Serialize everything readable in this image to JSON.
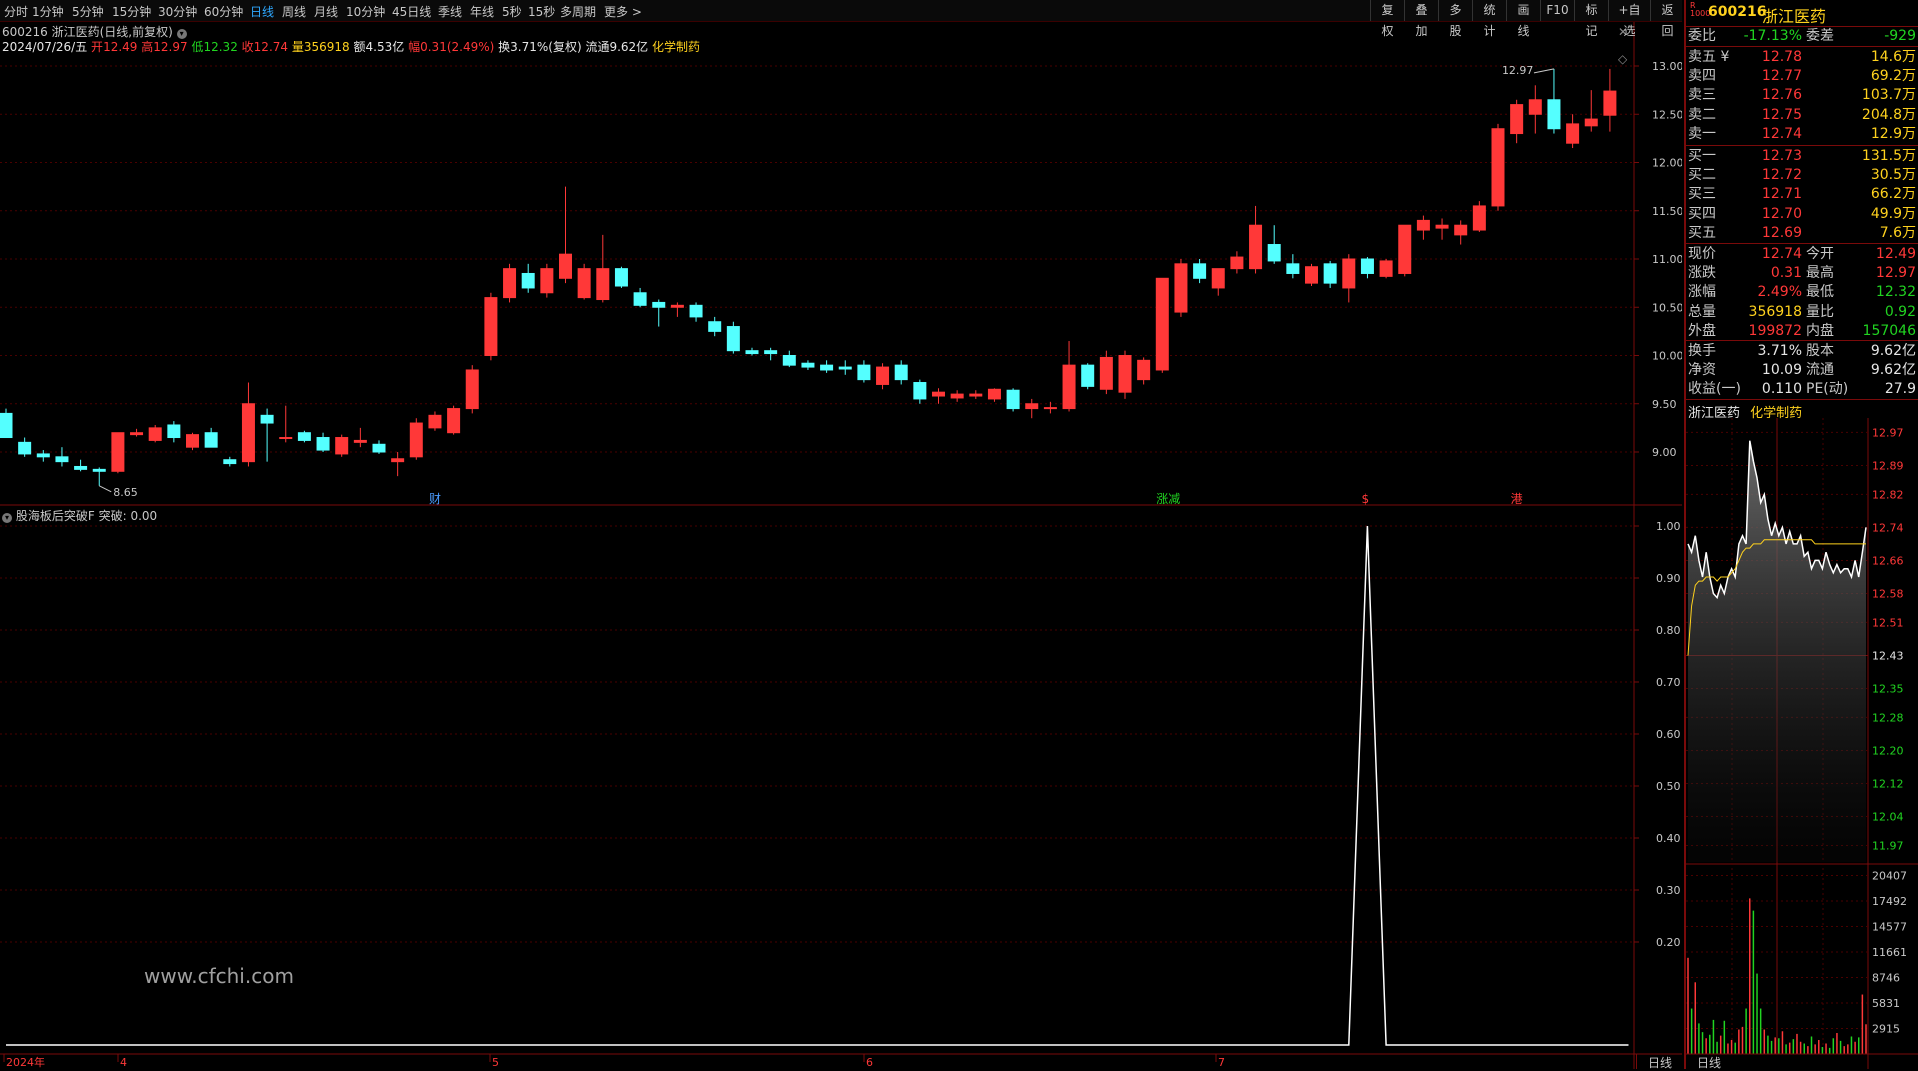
{
  "toolbar": {
    "periods": [
      "分时",
      "1分钟",
      "5分钟",
      "15分钟",
      "30分钟",
      "60分钟",
      "日线",
      "周线",
      "月线",
      "10分钟",
      "45日线",
      "季线",
      "年线",
      "5秒",
      "15秒",
      "多周期",
      "更多 >"
    ],
    "active_period": "日线",
    "right_buttons": [
      "复权",
      "叠加",
      "多股",
      "统计",
      "画线",
      "F10",
      "标记",
      "+自选",
      "返回"
    ]
  },
  "stock": {
    "code": "600216",
    "name": "浙江医药",
    "title_line": "600216 浙江医药(日线,前复权)",
    "industry": "化学制药",
    "date": "2024/07/26/五",
    "open_label": "开",
    "open": "12.49",
    "high_label": "高",
    "high": "12.97",
    "low_label": "低",
    "low": "12.32",
    "close_label": "收",
    "close": "12.74",
    "vol_label": "量",
    "volume": "356918",
    "amount_label": "额",
    "amount": "4.53亿",
    "change_label": "幅",
    "change": "0.31(2.49%)",
    "turnover_text": "换3.71%(复权) 流通9.62亿"
  },
  "chart_data": {
    "type": "candlestick",
    "title": "600216 浙江医药(日线,前复权)",
    "price_axis": [
      "13.00",
      "12.50",
      "12.00",
      "11.50",
      "11.00",
      "10.50",
      "10.00",
      "9.50",
      "9.00"
    ],
    "ylim": [
      8.4,
      13.3
    ],
    "candles": [
      {
        "o": 9.4,
        "h": 9.45,
        "l": 9.15,
        "c": 9.15
      },
      {
        "o": 9.1,
        "h": 9.15,
        "l": 8.95,
        "c": 8.98
      },
      {
        "o": 8.98,
        "h": 9.02,
        "l": 8.9,
        "c": 8.95
      },
      {
        "o": 8.95,
        "h": 9.05,
        "l": 8.85,
        "c": 8.9
      },
      {
        "o": 8.85,
        "h": 8.92,
        "l": 8.8,
        "c": 8.82
      },
      {
        "o": 8.82,
        "h": 8.84,
        "l": 8.65,
        "c": 8.8
      },
      {
        "o": 8.8,
        "h": 9.2,
        "l": 8.78,
        "c": 9.2
      },
      {
        "o": 9.18,
        "h": 9.24,
        "l": 9.16,
        "c": 9.2
      },
      {
        "o": 9.12,
        "h": 9.28,
        "l": 9.1,
        "c": 9.25
      },
      {
        "o": 9.28,
        "h": 9.32,
        "l": 9.1,
        "c": 9.15
      },
      {
        "o": 9.05,
        "h": 9.2,
        "l": 9.02,
        "c": 9.18
      },
      {
        "o": 9.2,
        "h": 9.25,
        "l": 9.05,
        "c": 9.05
      },
      {
        "o": 8.92,
        "h": 8.95,
        "l": 8.85,
        "c": 8.88
      },
      {
        "o": 8.9,
        "h": 9.72,
        "l": 8.85,
        "c": 9.5
      },
      {
        "o": 9.38,
        "h": 9.45,
        "l": 8.9,
        "c": 9.3
      },
      {
        "o": 9.15,
        "h": 9.48,
        "l": 9.1,
        "c": 9.15
      },
      {
        "o": 9.2,
        "h": 9.22,
        "l": 9.1,
        "c": 9.12
      },
      {
        "o": 9.15,
        "h": 9.2,
        "l": 9.0,
        "c": 9.02
      },
      {
        "o": 8.98,
        "h": 9.18,
        "l": 8.95,
        "c": 9.15
      },
      {
        "o": 9.1,
        "h": 9.25,
        "l": 9.05,
        "c": 9.12
      },
      {
        "o": 9.08,
        "h": 9.12,
        "l": 8.98,
        "c": 9.0
      },
      {
        "o": 8.9,
        "h": 9.0,
        "l": 8.75,
        "c": 8.93
      },
      {
        "o": 8.95,
        "h": 9.35,
        "l": 8.92,
        "c": 9.3
      },
      {
        "o": 9.25,
        "h": 9.42,
        "l": 9.22,
        "c": 9.38
      },
      {
        "o": 9.2,
        "h": 9.48,
        "l": 9.18,
        "c": 9.45
      },
      {
        "o": 9.45,
        "h": 9.9,
        "l": 9.4,
        "c": 9.85
      },
      {
        "o": 10.0,
        "h": 10.65,
        "l": 9.95,
        "c": 10.6
      },
      {
        "o": 10.6,
        "h": 10.95,
        "l": 10.55,
        "c": 10.9
      },
      {
        "o": 10.85,
        "h": 10.95,
        "l": 10.65,
        "c": 10.7
      },
      {
        "o": 10.65,
        "h": 10.95,
        "l": 10.6,
        "c": 10.9
      },
      {
        "o": 10.8,
        "h": 11.75,
        "l": 10.75,
        "c": 11.05
      },
      {
        "o": 10.6,
        "h": 10.95,
        "l": 10.58,
        "c": 10.9
      },
      {
        "o": 10.58,
        "h": 11.25,
        "l": 10.55,
        "c": 10.9
      },
      {
        "o": 10.9,
        "h": 10.92,
        "l": 10.7,
        "c": 10.72
      },
      {
        "o": 10.65,
        "h": 10.7,
        "l": 10.5,
        "c": 10.52
      },
      {
        "o": 10.55,
        "h": 10.58,
        "l": 10.3,
        "c": 10.5
      },
      {
        "o": 10.5,
        "h": 10.55,
        "l": 10.4,
        "c": 10.52
      },
      {
        "o": 10.52,
        "h": 10.55,
        "l": 10.35,
        "c": 10.4
      },
      {
        "o": 10.35,
        "h": 10.4,
        "l": 10.2,
        "c": 10.25
      },
      {
        "o": 10.3,
        "h": 10.35,
        "l": 10.02,
        "c": 10.05
      },
      {
        "o": 10.05,
        "h": 10.08,
        "l": 10.0,
        "c": 10.02
      },
      {
        "o": 10.05,
        "h": 10.08,
        "l": 9.95,
        "c": 10.02
      },
      {
        "o": 10.0,
        "h": 10.05,
        "l": 9.88,
        "c": 9.9
      },
      {
        "o": 9.92,
        "h": 9.95,
        "l": 9.85,
        "c": 9.88
      },
      {
        "o": 9.9,
        "h": 9.95,
        "l": 9.82,
        "c": 9.85
      },
      {
        "o": 9.88,
        "h": 9.95,
        "l": 9.8,
        "c": 9.86
      },
      {
        "o": 9.9,
        "h": 9.95,
        "l": 9.72,
        "c": 9.75
      },
      {
        "o": 9.7,
        "h": 9.92,
        "l": 9.65,
        "c": 9.88
      },
      {
        "o": 9.9,
        "h": 9.95,
        "l": 9.7,
        "c": 9.75
      },
      {
        "o": 9.72,
        "h": 9.75,
        "l": 9.5,
        "c": 9.55
      },
      {
        "o": 9.58,
        "h": 9.66,
        "l": 9.5,
        "c": 9.62
      },
      {
        "o": 9.56,
        "h": 9.64,
        "l": 9.52,
        "c": 9.6
      },
      {
        "o": 9.58,
        "h": 9.64,
        "l": 9.55,
        "c": 9.6
      },
      {
        "o": 9.55,
        "h": 9.66,
        "l": 9.52,
        "c": 9.65
      },
      {
        "o": 9.64,
        "h": 9.66,
        "l": 9.42,
        "c": 9.45
      },
      {
        "o": 9.45,
        "h": 9.55,
        "l": 9.35,
        "c": 9.5
      },
      {
        "o": 9.45,
        "h": 9.52,
        "l": 9.4,
        "c": 9.46
      },
      {
        "o": 9.45,
        "h": 10.15,
        "l": 9.42,
        "c": 9.9
      },
      {
        "o": 9.9,
        "h": 9.92,
        "l": 9.65,
        "c": 9.68
      },
      {
        "o": 9.65,
        "h": 10.05,
        "l": 9.6,
        "c": 9.98
      },
      {
        "o": 9.62,
        "h": 10.05,
        "l": 9.55,
        "c": 10.0
      },
      {
        "o": 9.75,
        "h": 9.98,
        "l": 9.7,
        "c": 9.95
      },
      {
        "o": 9.85,
        "h": 10.2,
        "l": 9.82,
        "c": 10.8
      },
      {
        "o": 10.45,
        "h": 11.0,
        "l": 10.4,
        "c": 10.95
      },
      {
        "o": 10.95,
        "h": 11.0,
        "l": 10.75,
        "c": 10.8
      },
      {
        "o": 10.7,
        "h": 10.9,
        "l": 10.62,
        "c": 10.9
      },
      {
        "o": 10.9,
        "h": 11.08,
        "l": 10.85,
        "c": 11.02
      },
      {
        "o": 10.9,
        "h": 11.55,
        "l": 10.85,
        "c": 11.35
      },
      {
        "o": 11.15,
        "h": 11.35,
        "l": 10.95,
        "c": 10.98
      },
      {
        "o": 10.95,
        "h": 11.05,
        "l": 10.8,
        "c": 10.85
      },
      {
        "o": 10.75,
        "h": 10.95,
        "l": 10.72,
        "c": 10.92
      },
      {
        "o": 10.95,
        "h": 10.98,
        "l": 10.7,
        "c": 10.75
      },
      {
        "o": 10.7,
        "h": 11.05,
        "l": 10.55,
        "c": 11.0
      },
      {
        "o": 11.0,
        "h": 11.02,
        "l": 10.8,
        "c": 10.85
      },
      {
        "o": 10.82,
        "h": 11.0,
        "l": 10.8,
        "c": 10.98
      },
      {
        "o": 10.85,
        "h": 11.35,
        "l": 10.82,
        "c": 11.35
      },
      {
        "o": 11.3,
        "h": 11.45,
        "l": 11.2,
        "c": 11.4
      },
      {
        "o": 11.32,
        "h": 11.42,
        "l": 11.2,
        "c": 11.35
      },
      {
        "o": 11.25,
        "h": 11.4,
        "l": 11.15,
        "c": 11.35
      },
      {
        "o": 11.3,
        "h": 11.6,
        "l": 11.28,
        "c": 11.55
      },
      {
        "o": 11.55,
        "h": 12.4,
        "l": 11.5,
        "c": 12.35
      },
      {
        "o": 12.3,
        "h": 12.65,
        "l": 12.2,
        "c": 12.6
      },
      {
        "o": 12.5,
        "h": 12.8,
        "l": 12.3,
        "c": 12.65
      },
      {
        "o": 12.65,
        "h": 12.97,
        "l": 12.3,
        "c": 12.35
      },
      {
        "o": 12.2,
        "h": 12.5,
        "l": 12.15,
        "c": 12.4
      },
      {
        "o": 12.38,
        "h": 12.75,
        "l": 12.32,
        "c": 12.45
      },
      {
        "o": 12.49,
        "h": 12.97,
        "l": 12.32,
        "c": 12.74
      }
    ],
    "high_marker": "12.97",
    "low_marker": "8.65",
    "event_markers": [
      {
        "index": 23,
        "text": "财",
        "color": "#4a9bff"
      },
      {
        "index": 62,
        "text": "涨减",
        "color": "#21d421"
      },
      {
        "index": 73,
        "text": "$",
        "color": "#ff3838"
      },
      {
        "index": 81,
        "text": "港",
        "color": "#ff3838"
      }
    ],
    "x_axis_labels": [
      "2024年",
      "4",
      "5",
      "6",
      "7"
    ],
    "indicator": {
      "name": "股海板后突破F",
      "series_name": "突破",
      "value": "0.00",
      "y_axis": [
        "1.00",
        "0.90",
        "0.80",
        "0.70",
        "0.60",
        "0.50",
        "0.40",
        "0.30",
        "0.20"
      ],
      "ylim": [
        0,
        1.0
      ],
      "values": [
        0,
        0,
        0,
        0,
        0,
        0,
        0,
        0,
        0,
        0,
        0,
        0,
        0,
        0,
        0,
        0,
        0,
        0,
        0,
        0,
        0,
        0,
        0,
        0,
        0,
        0,
        0,
        0,
        0,
        0,
        0,
        0,
        0,
        0,
        0,
        0,
        0,
        0,
        0,
        0,
        0,
        0,
        0,
        0,
        0,
        0,
        0,
        0,
        0,
        0,
        0,
        0,
        0,
        0,
        0,
        0,
        0,
        0,
        0,
        0,
        0,
        0,
        0,
        0,
        0,
        0,
        0,
        0,
        0,
        0,
        0,
        0,
        0,
        1,
        0,
        0,
        0,
        0,
        0,
        0,
        0,
        0,
        0,
        0,
        0,
        0,
        0,
        0
      ]
    },
    "watermark": "www.cfchi.com",
    "bottom_tab": "日线"
  },
  "quote": {
    "title_code": "600216",
    "title_name": "浙江医药",
    "webi_label": "委比",
    "webi": "-17.13%",
    "weicha_label": "委差",
    "weicha": "-929",
    "asks": [
      {
        "label": "卖五 ¥",
        "price": "12.78",
        "vol": "14.6万"
      },
      {
        "label": "卖四",
        "price": "12.77",
        "vol": "69.2万"
      },
      {
        "label": "卖三",
        "price": "12.76",
        "vol": "103.7万"
      },
      {
        "label": "卖二",
        "price": "12.75",
        "vol": "204.8万"
      },
      {
        "label": "卖一",
        "price": "12.74",
        "vol": "12.9万"
      }
    ],
    "bids": [
      {
        "label": "买一",
        "price": "12.73",
        "vol": "131.5万"
      },
      {
        "label": "买二",
        "price": "12.72",
        "vol": "30.5万"
      },
      {
        "label": "买三",
        "price": "12.71",
        "vol": "66.2万"
      },
      {
        "label": "买四",
        "price": "12.70",
        "vol": "49.9万"
      },
      {
        "label": "买五",
        "price": "12.69",
        "vol": "7.6万"
      }
    ],
    "stats1": [
      {
        "l1": "现价",
        "v1": "12.74",
        "c1": "red",
        "l2": "今开",
        "v2": "12.49",
        "c2": "red"
      },
      {
        "l1": "涨跌",
        "v1": "0.31",
        "c1": "red",
        "l2": "最高",
        "v2": "12.97",
        "c2": "red"
      },
      {
        "l1": "涨幅",
        "v1": "2.49%",
        "c1": "red",
        "l2": "最低",
        "v2": "12.32",
        "c2": "green"
      },
      {
        "l1": "总量",
        "v1": "356918",
        "c1": "yellow",
        "l2": "量比",
        "v2": "0.92",
        "c2": "green"
      },
      {
        "l1": "外盘",
        "v1": "199872",
        "c1": "red",
        "l2": "内盘",
        "v2": "157046",
        "c2": "green"
      }
    ],
    "stats2": [
      {
        "l1": "换手",
        "v1": "3.71%",
        "c1": "white",
        "l2": "股本",
        "v2": "9.62亿",
        "c2": "white"
      },
      {
        "l1": "净资",
        "v1": "10.09",
        "c1": "white",
        "l2": "流通",
        "v2": "9.62亿",
        "c2": "white"
      },
      {
        "l1": "收益(一)",
        "v1": "0.110",
        "c1": "white",
        "l2": "PE(动)",
        "v2": "27.9",
        "c2": "white"
      }
    ],
    "intraday_name": "浙江医药",
    "intraday_industry": "化学制药",
    "intraday_price_axis": [
      "12.97",
      "12.89",
      "12.82",
      "12.74",
      "12.66",
      "12.58",
      "12.51",
      "12.43",
      "12.35",
      "12.28",
      "12.20",
      "12.12",
      "12.04",
      "11.97"
    ],
    "intraday_vol_axis": [
      "20407",
      "17492",
      "14577",
      "11661",
      "8746",
      "5831",
      "2915"
    ],
    "intraday_ylim": [
      11.93,
      13.0
    ],
    "intraday_prev_close": 12.43,
    "intraday_prices": [
      12.7,
      12.68,
      12.72,
      12.66,
      12.62,
      12.68,
      12.62,
      12.58,
      12.57,
      12.6,
      12.58,
      12.62,
      12.64,
      12.62,
      12.7,
      12.72,
      12.7,
      12.95,
      12.9,
      12.86,
      12.8,
      12.82,
      12.76,
      12.72,
      12.75,
      12.72,
      12.74,
      12.7,
      12.73,
      12.7,
      12.7,
      12.72,
      12.67,
      12.68,
      12.64,
      12.66,
      12.66,
      12.64,
      12.68,
      12.65,
      12.63,
      12.65,
      12.63,
      12.64,
      12.64,
      12.62,
      12.66,
      12.62,
      12.68,
      12.74
    ],
    "intraday_avg": [
      12.43,
      12.55,
      12.6,
      12.61,
      12.61,
      12.62,
      12.62,
      12.62,
      12.61,
      12.62,
      12.62,
      12.62,
      12.63,
      12.64,
      12.66,
      12.68,
      12.69,
      12.69,
      12.7,
      12.7,
      12.7,
      12.71,
      12.71,
      12.71,
      12.71,
      12.71,
      12.71,
      12.71,
      12.71,
      12.71,
      12.71,
      12.71,
      12.71,
      12.71,
      12.71,
      12.7,
      12.7,
      12.7,
      12.7,
      12.7,
      12.7,
      12.7,
      12.7,
      12.7,
      12.7,
      12.7,
      12.7,
      12.7,
      12.7,
      12.7
    ],
    "intraday_vols": [
      11000,
      5200,
      8200,
      3500,
      2500,
      1800,
      2200,
      3900,
      1400,
      2100,
      3800,
      1200,
      1600,
      1300,
      2800,
      3100,
      5200,
      17800,
      16400,
      9200,
      5200,
      2800,
      2100,
      1500,
      1900,
      1800,
      2600,
      1100,
      1300,
      1700,
      2300,
      1400,
      1200,
      900,
      2000,
      1100,
      1600,
      800,
      1200,
      700,
      1800,
      2400,
      1500,
      900,
      1100,
      2000,
      1400,
      1900,
      6800,
      3400
    ],
    "bottom_tab": "日线"
  }
}
